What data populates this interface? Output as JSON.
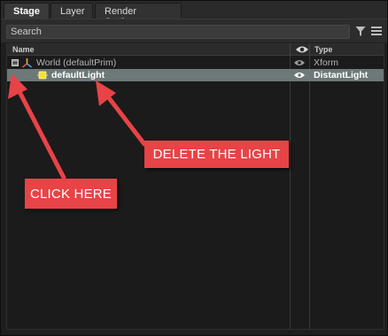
{
  "tabs": [
    {
      "label": "Stage",
      "active": true
    },
    {
      "label": "Layer",
      "active": false
    },
    {
      "label": "Render Settings",
      "active": false
    }
  ],
  "search": {
    "placeholder": "Search"
  },
  "toolbar": {
    "filter_icon": "filter-icon",
    "menu_icon": "hamburger-menu-icon"
  },
  "columns": {
    "name": "Name",
    "visibility_icon": "eye-icon",
    "type": "Type"
  },
  "tree": [
    {
      "name": "World (defaultPrim)",
      "type": "Xform",
      "icon": "xform-icon",
      "expanded": true,
      "selected": false
    },
    {
      "name": "defaultLight",
      "type": "DistantLight",
      "icon": "light-icon",
      "selected": true
    }
  ],
  "annotations": {
    "delete_callout": "DELETE THE LIGHT",
    "click_callout": "CLICK HERE",
    "color": "#e84346"
  },
  "colors": {
    "selection": "#6d7878",
    "background": "#1b1b1b"
  }
}
